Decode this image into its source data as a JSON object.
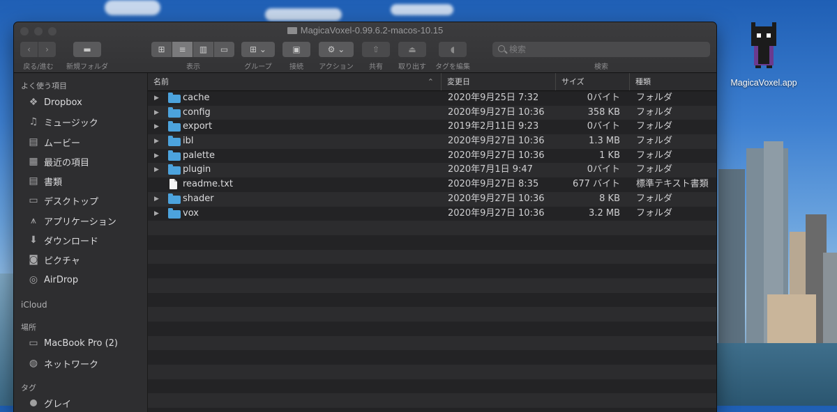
{
  "window": {
    "title": "MagicaVoxel-0.99.6.2-macos-10.15"
  },
  "toolbar": {
    "back_forward_label": "戻る/進む",
    "new_folder_label": "新規フォルダ",
    "view_label": "表示",
    "group_label": "グループ",
    "connect_label": "接続",
    "action_label": "アクション",
    "share_label": "共有",
    "eject_label": "取り出す",
    "tag_label": "タグを編集",
    "search_label": "検索",
    "search_placeholder": "検索"
  },
  "sidebar": {
    "favorites_header": "よく使う項目",
    "favorites": [
      {
        "label": "Dropbox",
        "icon": "dropbox-icon"
      },
      {
        "label": "ミュージック",
        "icon": "music-icon"
      },
      {
        "label": "ムービー",
        "icon": "movie-icon"
      },
      {
        "label": "最近の項目",
        "icon": "recents-icon"
      },
      {
        "label": "書類",
        "icon": "documents-icon"
      },
      {
        "label": "デスクトップ",
        "icon": "desktop-icon"
      },
      {
        "label": "アプリケーション",
        "icon": "applications-icon"
      },
      {
        "label": "ダウンロード",
        "icon": "downloads-icon"
      },
      {
        "label": "ピクチャ",
        "icon": "pictures-icon"
      },
      {
        "label": "AirDrop",
        "icon": "airdrop-icon"
      }
    ],
    "icloud_header": "iCloud",
    "locations_header": "場所",
    "locations": [
      {
        "label": "MacBook Pro (2)",
        "icon": "laptop-icon"
      },
      {
        "label": "ネットワーク",
        "icon": "network-icon"
      }
    ],
    "tags_header": "タグ",
    "tags": [
      {
        "label": "グレイ",
        "color": "#a0a0a0"
      }
    ]
  },
  "columns": {
    "name": "名前",
    "date": "変更日",
    "size": "サイズ",
    "kind": "種類"
  },
  "files": [
    {
      "name": "cache",
      "date": "2020年9月25日 7:32",
      "size": "0バイト",
      "kind": "フォルダ",
      "type": "folder"
    },
    {
      "name": "config",
      "date": "2020年9月27日 10:36",
      "size": "358 KB",
      "kind": "フォルダ",
      "type": "folder"
    },
    {
      "name": "export",
      "date": "2019年2月11日 9:23",
      "size": "0バイト",
      "kind": "フォルダ",
      "type": "folder"
    },
    {
      "name": "ibl",
      "date": "2020年9月27日 10:36",
      "size": "1.3 MB",
      "kind": "フォルダ",
      "type": "folder"
    },
    {
      "name": "palette",
      "date": "2020年9月27日 10:36",
      "size": "1 KB",
      "kind": "フォルダ",
      "type": "folder"
    },
    {
      "name": "plugin",
      "date": "2020年7月1日 9:47",
      "size": "0バイト",
      "kind": "フォルダ",
      "type": "folder"
    },
    {
      "name": "readme.txt",
      "date": "2020年9月27日 8:35",
      "size": "677 バイト",
      "kind": "標準テキスト書類",
      "type": "file"
    },
    {
      "name": "shader",
      "date": "2020年9月27日 10:36",
      "size": "8 KB",
      "kind": "フォルダ",
      "type": "folder"
    },
    {
      "name": "vox",
      "date": "2020年9月27日 10:36",
      "size": "3.2 MB",
      "kind": "フォルダ",
      "type": "folder"
    }
  ],
  "desktop": {
    "app_label": "MagicaVoxel.app"
  },
  "colors": {
    "folder": "#4ca3dd",
    "sky": "#3d7fd0"
  }
}
